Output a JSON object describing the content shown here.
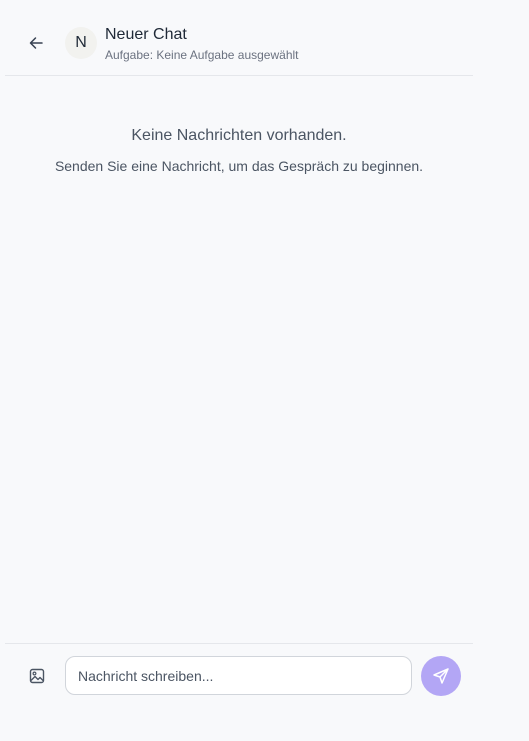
{
  "header": {
    "avatar_letter": "N",
    "title": "Neuer Chat",
    "subtitle": "Aufgabe: Keine Aufgabe ausgewählt"
  },
  "empty_state": {
    "title": "Keine Nachrichten vorhanden.",
    "subtitle": "Senden Sie eine Nachricht, um das Gespräch zu beginnen."
  },
  "composer": {
    "value": "",
    "placeholder": "Nachricht schreiben..."
  },
  "icons": {
    "back": "arrow-left-icon",
    "image": "image-icon",
    "send": "send-icon"
  },
  "colors": {
    "background": "#f8f9fb",
    "send_button": "#b3a6f5",
    "avatar_bg": "#f2f2ef"
  }
}
